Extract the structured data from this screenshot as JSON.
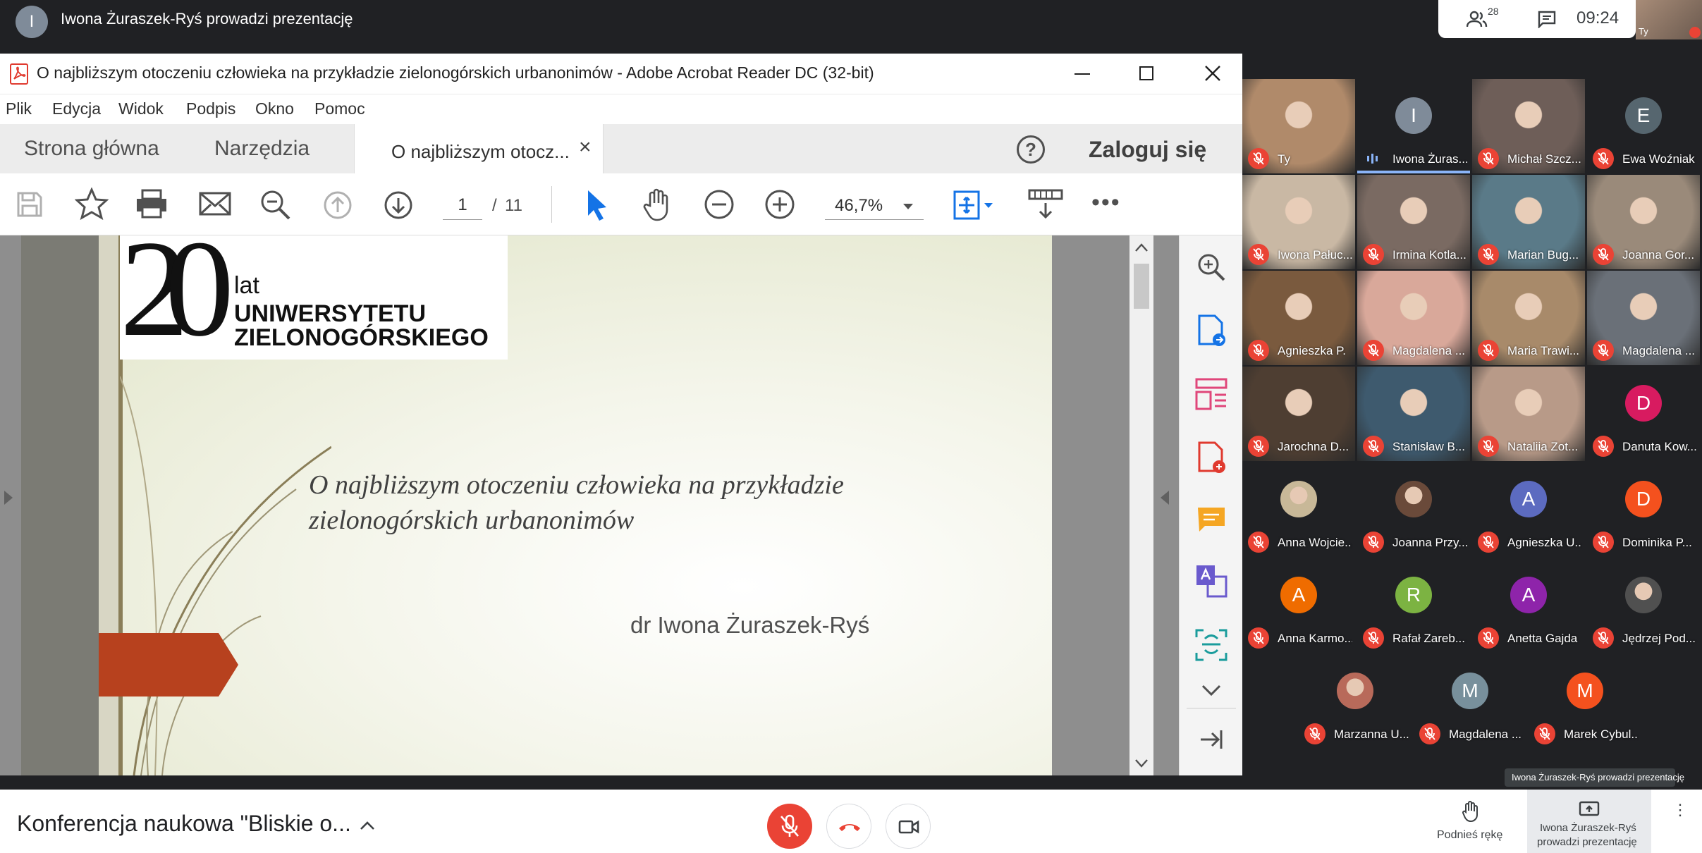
{
  "top_bar": {
    "presenter_initial": "I",
    "presenter_text": "Iwona Żuraszek-Ryś prowadzi prezentację",
    "participants_count": "28",
    "time": "09:24",
    "self_label": "Ty"
  },
  "acrobat": {
    "title": "O najbliższym otoczeniu człowieka na przykładzie zielonogórskich urbanonimów - Adobe Acrobat Reader DC (32-bit)",
    "menu": [
      "Plik",
      "Edycja",
      "Widok",
      "Podpis",
      "Okno",
      "Pomoc"
    ],
    "tabs": {
      "home": "Strona główna",
      "tools": "Narzędzia",
      "doc": "O najbliższym otocz...",
      "close": "×"
    },
    "help": "?",
    "login": "Zaloguj się",
    "page_current": "1",
    "page_sep": "/",
    "page_total": "11",
    "zoom": "46,7%"
  },
  "slide": {
    "logo_number": "20",
    "logo_line1": "lat",
    "logo_line2": "UNIWERSYTETU",
    "logo_line3": "ZIELONOGÓRSKIEGO",
    "title_line1": "O najbliższym otoczeniu człowieka na przykładzie",
    "title_line2": "zielonogórskich urbanonimów",
    "author": "dr Iwona Żuraszek-Ryś"
  },
  "participants": [
    {
      "name": "Ty",
      "type": "video",
      "color": "#b08a6a"
    },
    {
      "name": "Iwona Żuras...",
      "type": "initial",
      "initial": "I",
      "color": "#7f8b99",
      "speaking": true
    },
    {
      "name": "Michał Szcz...",
      "type": "video",
      "color": "#6e5e58"
    },
    {
      "name": "Ewa Woźniak",
      "type": "initial",
      "initial": "E",
      "color": "#56666f"
    },
    {
      "name": "Iwona Pałuc...",
      "type": "video",
      "color": "#c9b8a4"
    },
    {
      "name": "Irmina Kotla...",
      "type": "video",
      "color": "#7a6a62"
    },
    {
      "name": "Marian Bug...",
      "type": "video",
      "color": "#5a7a88"
    },
    {
      "name": "Joanna Gor...",
      "type": "video",
      "color": "#9a8a7a"
    },
    {
      "name": "Agnieszka P.",
      "type": "video",
      "color": "#7a5a3e"
    },
    {
      "name": "Magdalena ...",
      "type": "video",
      "color": "#d9a89a"
    },
    {
      "name": "Maria Trawi...",
      "type": "video",
      "color": "#a88a6a"
    },
    {
      "name": "Magdalena ...",
      "type": "video",
      "color": "#6a7078"
    },
    {
      "name": "Jarochna D...",
      "type": "video",
      "color": "#4e3e32"
    },
    {
      "name": "Stanisław B...",
      "type": "video",
      "color": "#3e5a6e"
    },
    {
      "name": "Nataliia Zot...",
      "type": "video",
      "color": "#b89a88"
    },
    {
      "name": "Danuta Kow...",
      "type": "initial",
      "initial": "D",
      "color": "#d81b60"
    },
    {
      "name": "Anna Wojcie...",
      "type": "photo",
      "color": "#c8b898"
    },
    {
      "name": "Joanna Przy...",
      "type": "photo",
      "color": "#6a4a3a"
    },
    {
      "name": "Agnieszka U...",
      "type": "initial",
      "initial": "A",
      "color": "#5c6bc0"
    },
    {
      "name": "Dominika P...",
      "type": "initial",
      "initial": "D",
      "color": "#f4511e"
    },
    {
      "name": "Anna Karmo...",
      "type": "initial",
      "initial": "A",
      "color": "#ef6c00"
    },
    {
      "name": "Rafał Zareb...",
      "type": "initial",
      "initial": "R",
      "color": "#7cb342"
    },
    {
      "name": "Anetta Gajda",
      "type": "initial",
      "initial": "A",
      "color": "#8e24aa"
    },
    {
      "name": "Jędrzej Pod...",
      "type": "photo",
      "color": "#505050"
    },
    {
      "name": "Marzanna U...",
      "type": "photo",
      "color": "#b86a5a"
    },
    {
      "name": "Magdalena ...",
      "type": "initial",
      "initial": "M",
      "color": "#78909c"
    },
    {
      "name": "Marek Cybul...",
      "type": "initial",
      "initial": "M",
      "color": "#f4511e"
    }
  ],
  "tooltip": "Iwona Żuraszek-Ryś prowadzi prezentację",
  "bottom": {
    "meeting_title": "Konferencja naukowa \"Bliskie o...",
    "raise_hand": "Podnieś rękę",
    "present_line1": "Iwona Żuraszek-Ryś",
    "present_line2": "prowadzi prezentację"
  },
  "colors": {
    "meet_red": "#ea4335",
    "acrobat_blue": "#1473e6",
    "slide_arrow": "#b7411e"
  }
}
